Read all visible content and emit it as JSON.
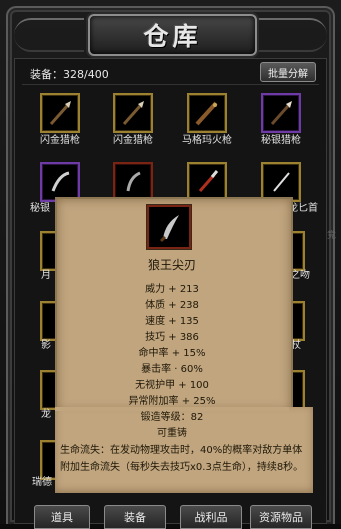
{
  "window": {
    "title": "仓库"
  },
  "header": {
    "capacity_text": "装备：328/400",
    "batch_button": "批量分解"
  },
  "grid": {
    "row1": [
      "闪金猎枪",
      "闪金猎枪",
      "马格玛火枪",
      "秘银猎枪"
    ],
    "row2": [
      "秘银",
      "",
      "",
      "龙匕首"
    ],
    "left_partial": [
      "月",
      "影",
      "龙",
      "瑞德"
    ],
    "right_partial": [
      "之吻",
      "杖",
      "法杖",
      "多"
    ]
  },
  "tooltip": {
    "name": "狼王尖刃",
    "stats": [
      "威力 + 213",
      "体质 + 238",
      "速度 + 135",
      "技巧 + 386",
      "命中率 + 15%",
      "暴击率 · 60%",
      "无视护甲 + 100",
      "异常附加率 + 25%",
      "锻造等级：82",
      "可重铸"
    ],
    "description": "生命流失：在发动物理攻击时，40%的概率对敌方单体附加生命流失（每秒失去技巧x0.3点生命），持续8秒。"
  },
  "tabs": [
    "道具",
    "装备",
    "战利品",
    "资源物品"
  ],
  "side_text": "竞",
  "colors": {
    "gold_border": "#9b8130",
    "purple_border": "#6e3aa6",
    "red_border": "#7a2414",
    "parchment": "#c0a57f"
  }
}
